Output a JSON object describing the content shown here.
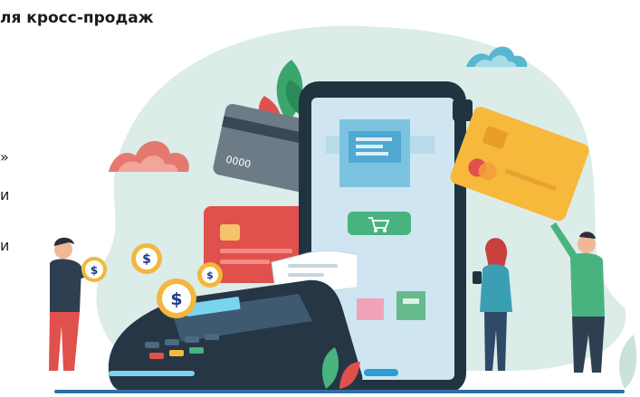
{
  "heading": {
    "text": "ля кросс-продаж"
  },
  "left_fragments": [
    "»",
    "и",
    "и"
  ],
  "illustration": {
    "phone": {
      "cart_icon": "cart-icon"
    },
    "coin_symbol": "$",
    "card_number": "0000",
    "colors": {
      "blob": "#dbece9",
      "phone_body": "#1f3440",
      "phone_screen": "#cfe6f2",
      "cart_button": "#49b37f",
      "card_yellow": "#f6b93b",
      "card_red": "#e0504d",
      "card_gray": "#6c7b86",
      "coin": "#f3b73b",
      "terminal": "#263645",
      "receipt": "#ffffff",
      "ground_line": "#2f6fa3"
    }
  }
}
